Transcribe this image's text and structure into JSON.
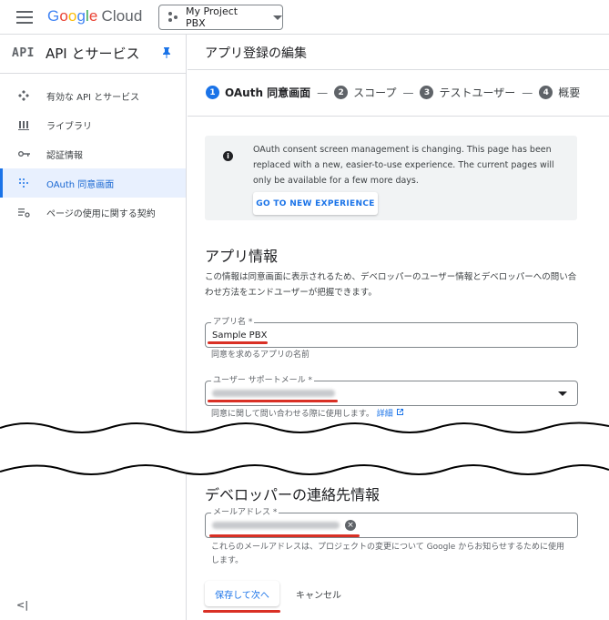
{
  "topbar": {
    "brand": {
      "google": "Google",
      "cloud": "Cloud"
    },
    "project": "My Project PBX"
  },
  "sidebar": {
    "badge": "API",
    "title": "API とサービス",
    "items": [
      {
        "label": "有効な API とサービス",
        "icon": "api-services-icon"
      },
      {
        "label": "ライブラリ",
        "icon": "library-icon"
      },
      {
        "label": "認証情報",
        "icon": "key-icon"
      },
      {
        "label": "OAuth 同意画面",
        "icon": "oauth-consent-icon",
        "active": true
      },
      {
        "label": "ページの使用に関する契約",
        "icon": "settings-list-icon"
      }
    ],
    "collapse": "<|"
  },
  "main": {
    "title": "アプリ登録の編集",
    "steps": [
      {
        "num": "1",
        "label": "OAuth 同意画面"
      },
      {
        "num": "2",
        "label": "スコープ"
      },
      {
        "num": "3",
        "label": "テストユーザー"
      },
      {
        "num": "4",
        "label": "概要"
      }
    ],
    "step_separator": "—",
    "notice": {
      "message": "OAuth consent screen management is changing. This page has been replaced with a new, easier-to-use experience. The current pages will only be available for a few more days.",
      "button": "GO TO NEW EXPERIENCE"
    },
    "app_info": {
      "title": "アプリ情報",
      "description": "この情報は同意画面に表示されるため、デベロッパーのユーザー情報とデベロッパーへの問い合わせ方法をエンドユーザーが把握できます。",
      "app_name_label": "アプリ名 *",
      "app_name_value": "Sample PBX",
      "app_name_hint": "同意を求めるアプリの名前",
      "support_email_label": "ユーザー サポートメール *",
      "support_email_hint": "同意に関して問い合わせる際に使用します。",
      "support_email_link": "詳細"
    },
    "developer": {
      "title": "デベロッパーの連絡先情報",
      "email_label": "メールアドレス *",
      "email_hint": "これらのメールアドレスは、プロジェクトの変更について Google からお知らせするために使用します。"
    },
    "actions": {
      "save": "保存して次へ",
      "cancel": "キャンセル"
    }
  },
  "colors": {
    "accent": "#1a73e8",
    "highlight": "#d93025"
  }
}
